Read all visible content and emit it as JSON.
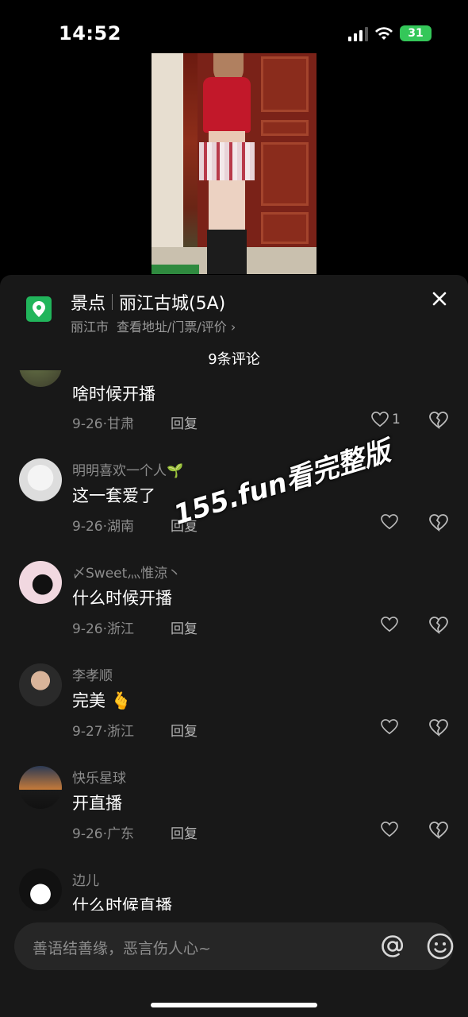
{
  "status_bar": {
    "time": "14:52",
    "battery": "31"
  },
  "poi": {
    "category": "景点",
    "name": "丽江古城(5A)",
    "city": "丽江市",
    "link": "查看地址/门票/评价 ›"
  },
  "comments_header": "9条评论",
  "comments": [
    {
      "name": "",
      "text": "啥时候开播",
      "date": "9-26",
      "region": "甘肃",
      "reply": "回复",
      "likes": "1"
    },
    {
      "name": "明明喜欢一个人🌱",
      "text": "这一套爱了",
      "date": "9-26",
      "region": "湖南",
      "reply": "回复",
      "likes": ""
    },
    {
      "name": "〆Sweet灬惟涼丶",
      "text": "什么时候开播",
      "date": "9-26",
      "region": "浙江",
      "reply": "回复",
      "likes": ""
    },
    {
      "name": "李孝顺",
      "text": "完美 🫰",
      "date": "9-27",
      "region": "浙江",
      "reply": "回复",
      "likes": ""
    },
    {
      "name": "快乐星球",
      "text": "开直播",
      "date": "9-26",
      "region": "广东",
      "reply": "回复",
      "likes": ""
    },
    {
      "name": "边儿",
      "text": "什么时候直播",
      "date": "",
      "region": "",
      "reply": "",
      "likes": ""
    }
  ],
  "meta_separator": "·",
  "watermark": "155.fun看完整版",
  "input": {
    "placeholder": "善语结善缘，恶言伤人心~"
  },
  "colors": {
    "accent_green": "#21b55b",
    "battery_green": "#34c759",
    "sheet_bg": "#181818"
  }
}
